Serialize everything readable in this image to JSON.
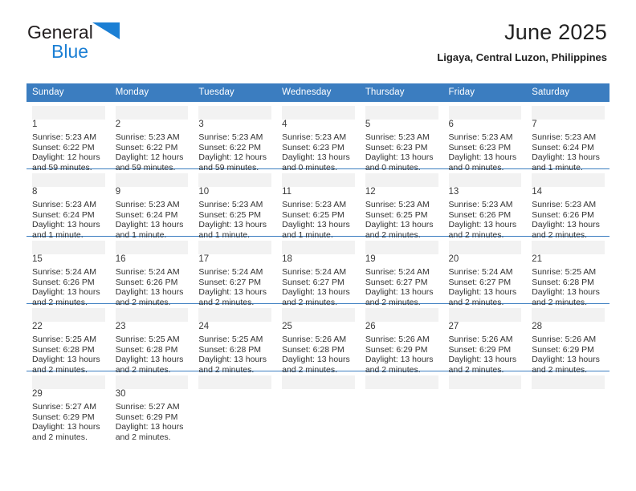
{
  "brand": {
    "name_top": "General",
    "name_bottom": "Blue",
    "logo_icon": "blue-triangle-icon",
    "accent_color": "#1b7fd4"
  },
  "header": {
    "title": "June 2025",
    "subtitle": "Ligaya, Central Luzon, Philippines"
  },
  "calendar": {
    "header_bg": "#3b7dc0",
    "header_text_color": "#ffffff",
    "weekdays": [
      "Sunday",
      "Monday",
      "Tuesday",
      "Wednesday",
      "Thursday",
      "Friday",
      "Saturday"
    ],
    "weeks": [
      [
        {
          "day": "1",
          "sunrise": "Sunrise: 5:23 AM",
          "sunset": "Sunset: 6:22 PM",
          "daylight_line1": "Daylight: 12 hours",
          "daylight_line2": "and 59 minutes."
        },
        {
          "day": "2",
          "sunrise": "Sunrise: 5:23 AM",
          "sunset": "Sunset: 6:22 PM",
          "daylight_line1": "Daylight: 12 hours",
          "daylight_line2": "and 59 minutes."
        },
        {
          "day": "3",
          "sunrise": "Sunrise: 5:23 AM",
          "sunset": "Sunset: 6:22 PM",
          "daylight_line1": "Daylight: 12 hours",
          "daylight_line2": "and 59 minutes."
        },
        {
          "day": "4",
          "sunrise": "Sunrise: 5:23 AM",
          "sunset": "Sunset: 6:23 PM",
          "daylight_line1": "Daylight: 13 hours",
          "daylight_line2": "and 0 minutes."
        },
        {
          "day": "5",
          "sunrise": "Sunrise: 5:23 AM",
          "sunset": "Sunset: 6:23 PM",
          "daylight_line1": "Daylight: 13 hours",
          "daylight_line2": "and 0 minutes."
        },
        {
          "day": "6",
          "sunrise": "Sunrise: 5:23 AM",
          "sunset": "Sunset: 6:23 PM",
          "daylight_line1": "Daylight: 13 hours",
          "daylight_line2": "and 0 minutes."
        },
        {
          "day": "7",
          "sunrise": "Sunrise: 5:23 AM",
          "sunset": "Sunset: 6:24 PM",
          "daylight_line1": "Daylight: 13 hours",
          "daylight_line2": "and 1 minute."
        }
      ],
      [
        {
          "day": "8",
          "sunrise": "Sunrise: 5:23 AM",
          "sunset": "Sunset: 6:24 PM",
          "daylight_line1": "Daylight: 13 hours",
          "daylight_line2": "and 1 minute."
        },
        {
          "day": "9",
          "sunrise": "Sunrise: 5:23 AM",
          "sunset": "Sunset: 6:24 PM",
          "daylight_line1": "Daylight: 13 hours",
          "daylight_line2": "and 1 minute."
        },
        {
          "day": "10",
          "sunrise": "Sunrise: 5:23 AM",
          "sunset": "Sunset: 6:25 PM",
          "daylight_line1": "Daylight: 13 hours",
          "daylight_line2": "and 1 minute."
        },
        {
          "day": "11",
          "sunrise": "Sunrise: 5:23 AM",
          "sunset": "Sunset: 6:25 PM",
          "daylight_line1": "Daylight: 13 hours",
          "daylight_line2": "and 1 minute."
        },
        {
          "day": "12",
          "sunrise": "Sunrise: 5:23 AM",
          "sunset": "Sunset: 6:25 PM",
          "daylight_line1": "Daylight: 13 hours",
          "daylight_line2": "and 2 minutes."
        },
        {
          "day": "13",
          "sunrise": "Sunrise: 5:23 AM",
          "sunset": "Sunset: 6:26 PM",
          "daylight_line1": "Daylight: 13 hours",
          "daylight_line2": "and 2 minutes."
        },
        {
          "day": "14",
          "sunrise": "Sunrise: 5:23 AM",
          "sunset": "Sunset: 6:26 PM",
          "daylight_line1": "Daylight: 13 hours",
          "daylight_line2": "and 2 minutes."
        }
      ],
      [
        {
          "day": "15",
          "sunrise": "Sunrise: 5:24 AM",
          "sunset": "Sunset: 6:26 PM",
          "daylight_line1": "Daylight: 13 hours",
          "daylight_line2": "and 2 minutes."
        },
        {
          "day": "16",
          "sunrise": "Sunrise: 5:24 AM",
          "sunset": "Sunset: 6:26 PM",
          "daylight_line1": "Daylight: 13 hours",
          "daylight_line2": "and 2 minutes."
        },
        {
          "day": "17",
          "sunrise": "Sunrise: 5:24 AM",
          "sunset": "Sunset: 6:27 PM",
          "daylight_line1": "Daylight: 13 hours",
          "daylight_line2": "and 2 minutes."
        },
        {
          "day": "18",
          "sunrise": "Sunrise: 5:24 AM",
          "sunset": "Sunset: 6:27 PM",
          "daylight_line1": "Daylight: 13 hours",
          "daylight_line2": "and 2 minutes."
        },
        {
          "day": "19",
          "sunrise": "Sunrise: 5:24 AM",
          "sunset": "Sunset: 6:27 PM",
          "daylight_line1": "Daylight: 13 hours",
          "daylight_line2": "and 2 minutes."
        },
        {
          "day": "20",
          "sunrise": "Sunrise: 5:24 AM",
          "sunset": "Sunset: 6:27 PM",
          "daylight_line1": "Daylight: 13 hours",
          "daylight_line2": "and 2 minutes."
        },
        {
          "day": "21",
          "sunrise": "Sunrise: 5:25 AM",
          "sunset": "Sunset: 6:28 PM",
          "daylight_line1": "Daylight: 13 hours",
          "daylight_line2": "and 2 minutes."
        }
      ],
      [
        {
          "day": "22",
          "sunrise": "Sunrise: 5:25 AM",
          "sunset": "Sunset: 6:28 PM",
          "daylight_line1": "Daylight: 13 hours",
          "daylight_line2": "and 2 minutes."
        },
        {
          "day": "23",
          "sunrise": "Sunrise: 5:25 AM",
          "sunset": "Sunset: 6:28 PM",
          "daylight_line1": "Daylight: 13 hours",
          "daylight_line2": "and 2 minutes."
        },
        {
          "day": "24",
          "sunrise": "Sunrise: 5:25 AM",
          "sunset": "Sunset: 6:28 PM",
          "daylight_line1": "Daylight: 13 hours",
          "daylight_line2": "and 2 minutes."
        },
        {
          "day": "25",
          "sunrise": "Sunrise: 5:26 AM",
          "sunset": "Sunset: 6:28 PM",
          "daylight_line1": "Daylight: 13 hours",
          "daylight_line2": "and 2 minutes."
        },
        {
          "day": "26",
          "sunrise": "Sunrise: 5:26 AM",
          "sunset": "Sunset: 6:29 PM",
          "daylight_line1": "Daylight: 13 hours",
          "daylight_line2": "and 2 minutes."
        },
        {
          "day": "27",
          "sunrise": "Sunrise: 5:26 AM",
          "sunset": "Sunset: 6:29 PM",
          "daylight_line1": "Daylight: 13 hours",
          "daylight_line2": "and 2 minutes."
        },
        {
          "day": "28",
          "sunrise": "Sunrise: 5:26 AM",
          "sunset": "Sunset: 6:29 PM",
          "daylight_line1": "Daylight: 13 hours",
          "daylight_line2": "and 2 minutes."
        }
      ],
      [
        {
          "day": "29",
          "sunrise": "Sunrise: 5:27 AM",
          "sunset": "Sunset: 6:29 PM",
          "daylight_line1": "Daylight: 13 hours",
          "daylight_line2": "and 2 minutes."
        },
        {
          "day": "30",
          "sunrise": "Sunrise: 5:27 AM",
          "sunset": "Sunset: 6:29 PM",
          "daylight_line1": "Daylight: 13 hours",
          "daylight_line2": "and 2 minutes."
        },
        {
          "day": "",
          "sunrise": "",
          "sunset": "",
          "daylight_line1": "",
          "daylight_line2": ""
        },
        {
          "day": "",
          "sunrise": "",
          "sunset": "",
          "daylight_line1": "",
          "daylight_line2": ""
        },
        {
          "day": "",
          "sunrise": "",
          "sunset": "",
          "daylight_line1": "",
          "daylight_line2": ""
        },
        {
          "day": "",
          "sunrise": "",
          "sunset": "",
          "daylight_line1": "",
          "daylight_line2": ""
        },
        {
          "day": "",
          "sunrise": "",
          "sunset": "",
          "daylight_line1": "",
          "daylight_line2": ""
        }
      ]
    ]
  }
}
